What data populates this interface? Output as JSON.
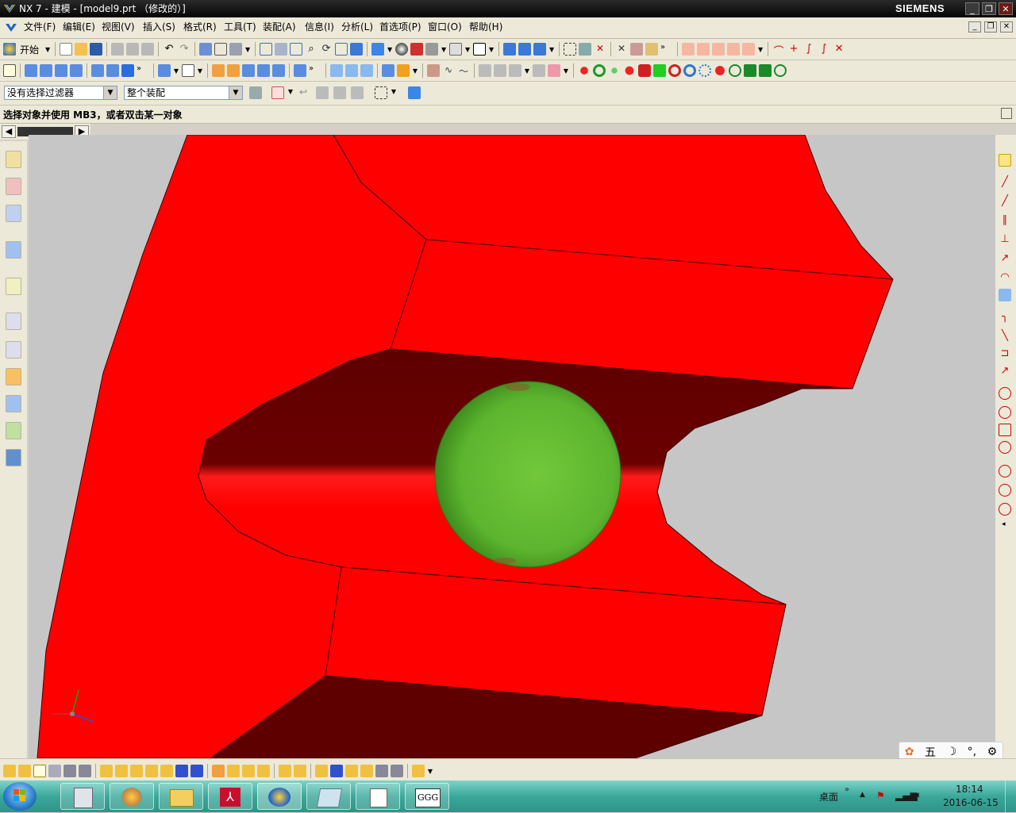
{
  "window": {
    "title": "NX 7 - 建模 - [model9.prt （修改的）]",
    "brand": "SIEMENS",
    "minimize": "_",
    "restore": "❐",
    "close": "✕"
  },
  "menubar": {
    "items": [
      "文件(F)",
      "编辑(E)",
      "视图(V)",
      "插入(S)",
      "格式(R)",
      "工具(T)",
      "装配(A)",
      "信息(I)",
      "分析(L)",
      "首选项(P)",
      "窗口(O)",
      "帮助(H)"
    ]
  },
  "toolbar": {
    "start_label": "开始",
    "filter_value": "没有选择过滤器",
    "scope_value": "整个装配"
  },
  "status": {
    "prompt": "选择对象并使用 MB3，或者双击某一对象"
  },
  "model": {
    "body_color": "#ff0000",
    "shadow_color": "#6a0000",
    "sphere_color": "#5cb52e",
    "background_color": "#c6c6c6"
  },
  "ime": {
    "mode_label": "五"
  },
  "taskbar": {
    "desktop_label": "桌面",
    "time": "18:14",
    "date": "2016-06-15"
  }
}
